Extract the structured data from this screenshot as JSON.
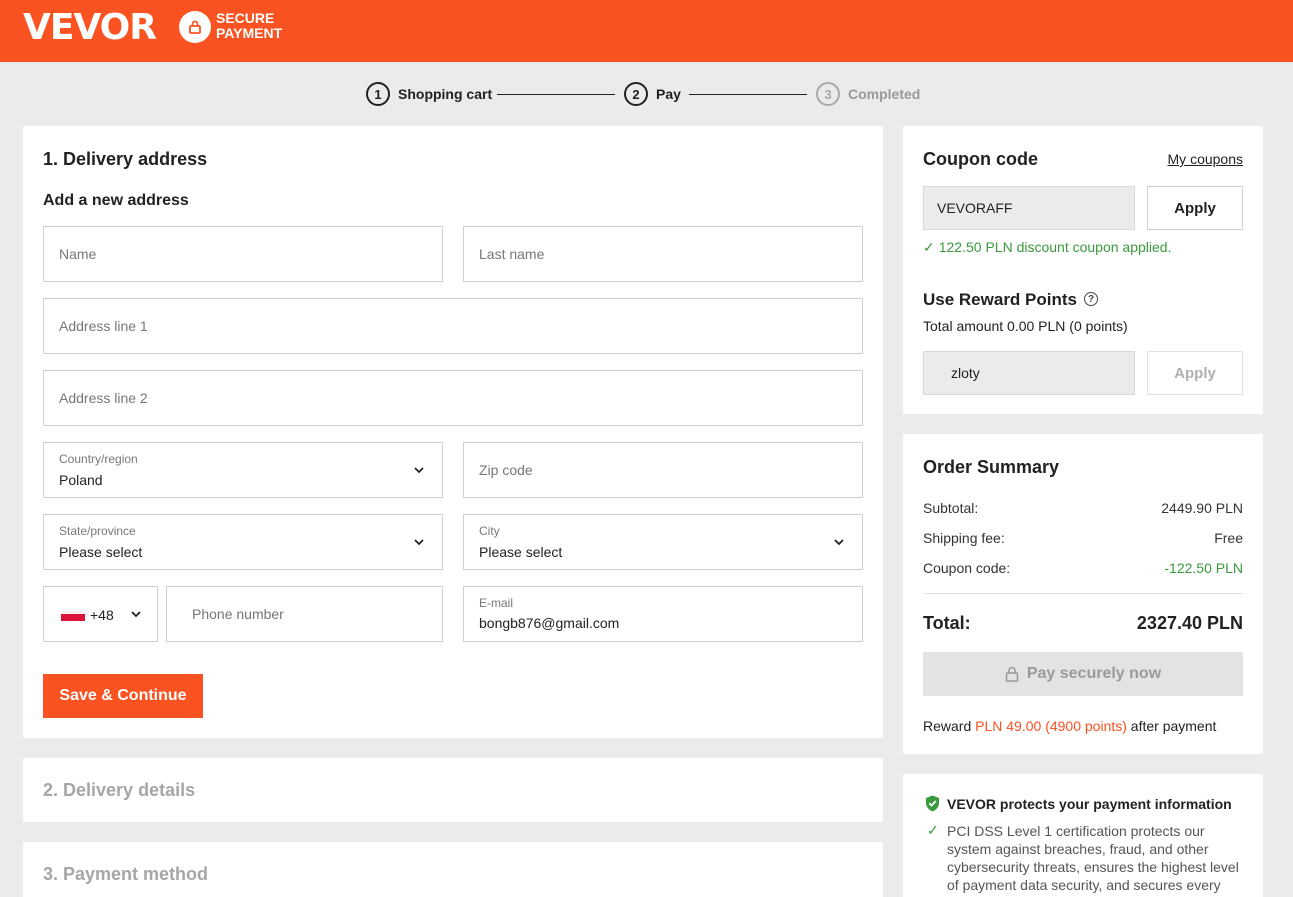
{
  "header": {
    "brand": "VEVOR",
    "secure_line1": "SECURE",
    "secure_line2": "PAYMENT"
  },
  "steps": [
    {
      "num": "1",
      "label": "Shopping cart",
      "state": "done"
    },
    {
      "num": "2",
      "label": "Pay",
      "state": "active"
    },
    {
      "num": "3",
      "label": "Completed",
      "state": "pending"
    }
  ],
  "delivery": {
    "title": "1. Delivery address",
    "subtitle": "Add a new address",
    "name_placeholder": "Name",
    "last_name_placeholder": "Last name",
    "address1_placeholder": "Address line 1",
    "address2_placeholder": "Address line 2",
    "country_label": "Country/region",
    "country_value": "Poland",
    "zip_placeholder": "Zip code",
    "state_label": "State/province",
    "state_value": "Please select",
    "city_label": "City",
    "city_value": "Please select",
    "phone_code": "+48",
    "phone_placeholder": "Phone number",
    "email_label": "E-mail",
    "email_value": "bongb876@gmail.com",
    "save_button": "Save & Continue"
  },
  "collapsed_sections": [
    {
      "title": "2. Delivery details"
    },
    {
      "title": "3. Payment method"
    }
  ],
  "coupon": {
    "title": "Coupon code",
    "my_coupons": "My coupons",
    "code_value": "VEVORAFF",
    "apply_label": "Apply",
    "applied_message": "122.50 PLN discount coupon applied."
  },
  "reward": {
    "title": "Use Reward Points",
    "total_text": "Total amount 0.00 PLN (0 points)",
    "input_value": "zloty",
    "apply_label": "Apply"
  },
  "summary": {
    "title": "Order Summary",
    "subtotal_label": "Subtotal:",
    "subtotal_value": "2449.90 PLN",
    "shipping_label": "Shipping fee:",
    "shipping_value": "Free",
    "coupon_label": "Coupon code:",
    "coupon_value": "-122.50 PLN",
    "total_label": "Total:",
    "total_value": "2327.40 PLN",
    "pay_button": "Pay securely now",
    "reward_prefix": "Reward ",
    "reward_amount": "PLN 49.00 (4900 points)",
    "reward_suffix": " after payment"
  },
  "security": {
    "title": "VEVOR protects your payment information",
    "text": "PCI DSS Level 1 certification protects our system against breaches, fraud, and other cybersecurity threats, ensures the highest level of payment data security, and secures every transaction on"
  },
  "colors": {
    "brand": "#fa5220",
    "success": "#3a9a3e",
    "background": "#ebebed"
  }
}
